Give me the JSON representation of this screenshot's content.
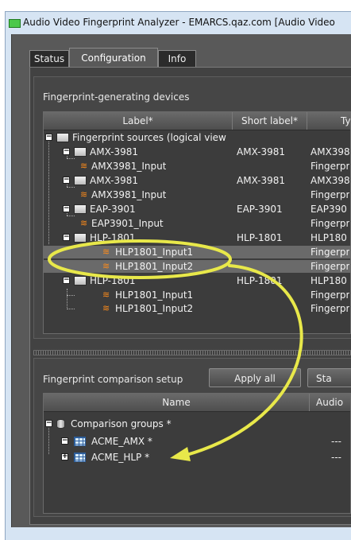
{
  "window": {
    "title": "Audio Video Fingerprint Analyzer - EMARCS.qaz.com [Audio Video"
  },
  "tabs": [
    {
      "label": "Status",
      "active": false
    },
    {
      "label": "Configuration",
      "active": true
    },
    {
      "label": "Info",
      "active": false
    }
  ],
  "devices": {
    "heading": "Fingerprint-generating devices",
    "columns": [
      "Label*",
      "Short label*",
      "Ty"
    ],
    "rows": [
      {
        "label": "Fingerprint sources (logical view",
        "short": "",
        "type": ""
      },
      {
        "label": "AMX-3981",
        "short": "AMX-3981",
        "type": "AMX398"
      },
      {
        "label": "AMX3981_Input",
        "short": "",
        "type": "Fingerpr"
      },
      {
        "label": "AMX-3981",
        "short": "AMX-3981",
        "type": "AMX398"
      },
      {
        "label": "AMX3981_Input",
        "short": "",
        "type": "Fingerpr"
      },
      {
        "label": "EAP-3901",
        "short": "EAP-3901",
        "type": "EAP390"
      },
      {
        "label": "EAP3901_Input",
        "short": "",
        "type": "Fingerpr"
      },
      {
        "label": "HLP-1801",
        "short": "HLP-1801",
        "type": "HLP180"
      },
      {
        "label": "HLP1801_Input1",
        "short": "",
        "type": "Fingerpr"
      },
      {
        "label": "HLP1801_Input2",
        "short": "",
        "type": "Fingerpr"
      },
      {
        "label": "HLP-1801",
        "short": "HLP-1801",
        "type": "HLP180"
      },
      {
        "label": "HLP1801_Input1",
        "short": "",
        "type": "Fingerpr"
      },
      {
        "label": "HLP1801_Input2",
        "short": "",
        "type": "Fingerpr"
      }
    ]
  },
  "comparison": {
    "heading": "Fingerprint comparison setup",
    "apply_all": "Apply all",
    "start": "Sta",
    "columns": [
      "Name",
      "Audio"
    ],
    "rows": [
      {
        "label": "Comparison groups *",
        "audio": ""
      },
      {
        "label": "ACME_AMX *",
        "audio": "---"
      },
      {
        "label": "ACME_HLP *",
        "audio": "---"
      }
    ]
  },
  "annotation_color": "#e8e84a",
  "highlight_color": "#6a6a6a"
}
